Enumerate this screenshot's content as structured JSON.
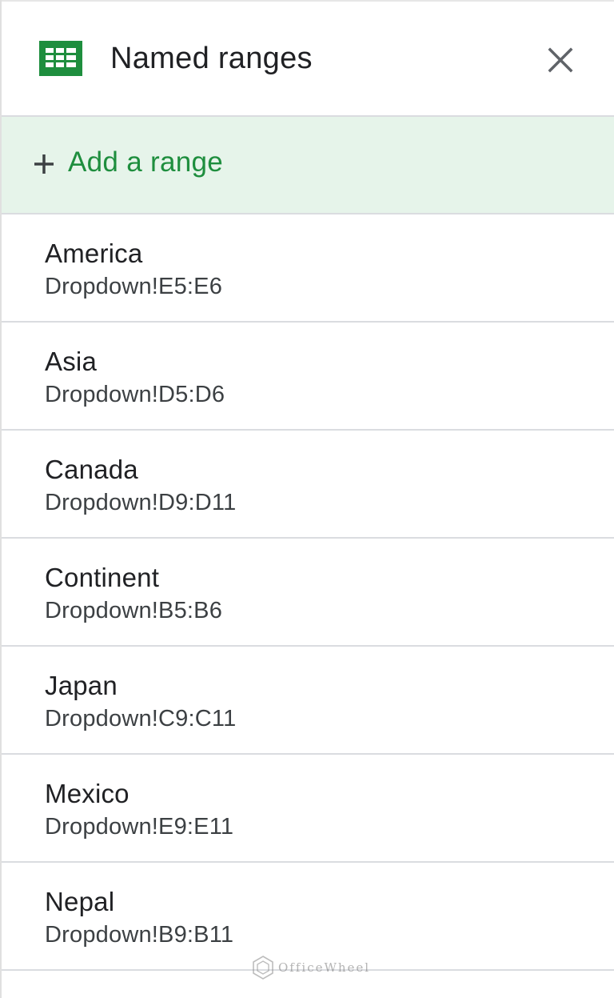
{
  "panel": {
    "title": "Named ranges",
    "close_icon": "close-icon",
    "app_icon": "google-sheets-icon"
  },
  "add_range": {
    "label": "Add a range",
    "icon": "plus-icon"
  },
  "ranges": [
    {
      "name": "America",
      "ref": "Dropdown!E5:E6"
    },
    {
      "name": "Asia",
      "ref": "Dropdown!D5:D6"
    },
    {
      "name": "Canada",
      "ref": "Dropdown!D9:D11"
    },
    {
      "name": "Continent",
      "ref": "Dropdown!B5:B6"
    },
    {
      "name": "Japan",
      "ref": "Dropdown!C9:C11"
    },
    {
      "name": "Mexico",
      "ref": "Dropdown!E9:E11"
    },
    {
      "name": "Nepal",
      "ref": "Dropdown!B9:B11"
    }
  ],
  "watermark": {
    "text": "OfficeWheel"
  },
  "colors": {
    "sheets_green": "#1e8e3e",
    "add_bg": "#e6f4ea",
    "text": "#202124",
    "divider": "#dadce0"
  }
}
